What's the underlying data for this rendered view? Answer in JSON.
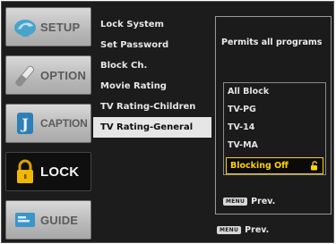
{
  "tabs": [
    {
      "label": "SETUP",
      "icon": "setup-icon",
      "active": false
    },
    {
      "label": "OPTION",
      "icon": "option-icon",
      "active": false
    },
    {
      "label": "CAPTION",
      "icon": "caption-icon",
      "active": false
    },
    {
      "label": "LOCK",
      "icon": "lock-icon",
      "active": true
    },
    {
      "label": "GUIDE",
      "icon": "guide-icon",
      "active": false
    }
  ],
  "menu": {
    "items": [
      {
        "label": "Lock System"
      },
      {
        "label": "Set Password"
      },
      {
        "label": "Block Ch."
      },
      {
        "label": "Movie Rating"
      },
      {
        "label": "TV Rating-Children"
      },
      {
        "label": "TV Rating-General"
      }
    ],
    "selected_index": 5
  },
  "panel": {
    "title": "Permits all programs",
    "options": [
      "All Block",
      "TV-PG",
      "TV-14",
      "TV-MA"
    ],
    "selected_option": "Blocking Off",
    "prev": {
      "key_label": "MENU",
      "label": "Prev."
    }
  },
  "footer": {
    "prev": {
      "key_label": "MENU",
      "label": "Prev."
    }
  },
  "colors": {
    "background": "#1c1c1c",
    "highlight": "#ffd200",
    "menu_active_bg": "#e6e6e6"
  }
}
